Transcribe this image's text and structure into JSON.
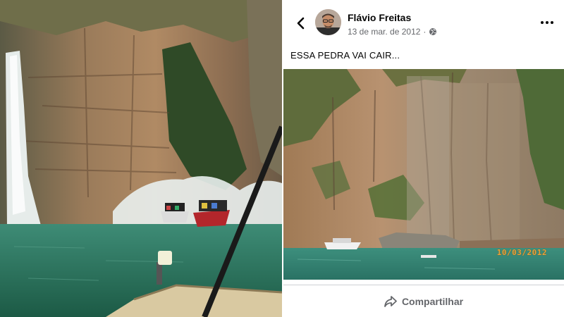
{
  "post": {
    "author": "Flávio Freitas",
    "date": "13 de mar. de 2012",
    "separator": "·",
    "text": "ESSA PEDRA VAI CAIR...",
    "photo_timestamp": "10/03/2012",
    "share_label": "Compartilhar"
  },
  "icons": {
    "back": "chevron-left-icon",
    "privacy": "globe-icon",
    "menu": "more-horizontal-icon",
    "share": "share-arrow-icon"
  },
  "colors": {
    "name_text": "#050505",
    "meta_text": "#65676b",
    "stamp": "#e8a23a",
    "lake": "#2f7c67"
  }
}
